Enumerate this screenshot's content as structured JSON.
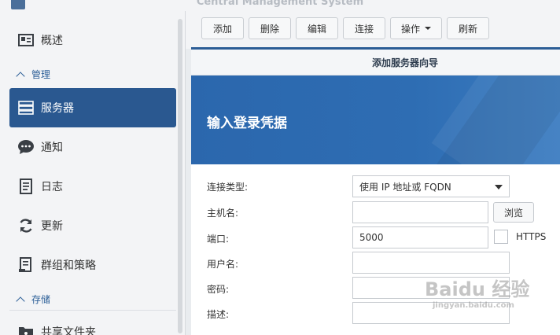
{
  "window": {
    "title": "Central Management System"
  },
  "sidebar": {
    "items": [
      {
        "label": "概述",
        "icon": "overview-icon"
      },
      {
        "label": "服务器",
        "icon": "server-icon",
        "active": true
      },
      {
        "label": "通知",
        "icon": "chat-bubble-icon"
      },
      {
        "label": "日志",
        "icon": "log-icon"
      },
      {
        "label": "更新",
        "icon": "refresh-icon"
      },
      {
        "label": "群组和策略",
        "icon": "policy-icon"
      },
      {
        "label": "共享文件夹",
        "icon": "shared-folder-icon"
      }
    ],
    "sections": [
      {
        "label": "管理"
      },
      {
        "label": "存储"
      }
    ]
  },
  "toolbar": {
    "add": "添加",
    "delete": "删除",
    "edit": "编辑",
    "connect": "连接",
    "actions": "操作",
    "refresh": "刷新"
  },
  "wizard": {
    "title": "添加服务器向导",
    "heading": "输入登录凭据",
    "form": {
      "connection_type_label": "连接类型:",
      "connection_type_value": "使用 IP 地址或 FQDN",
      "hostname_label": "主机名:",
      "hostname_value": "",
      "browse": "浏览",
      "port_label": "端口:",
      "port_value": "5000",
      "https_label": "HTTPS",
      "username_label": "用户名:",
      "password_label": "密码:",
      "description_label": "描述:"
    }
  },
  "watermark": {
    "text": "Baidu 经验",
    "url": "jingyan.baidu.com"
  },
  "colors": {
    "accent": "#2a5890",
    "banner": "#2e6db3"
  }
}
